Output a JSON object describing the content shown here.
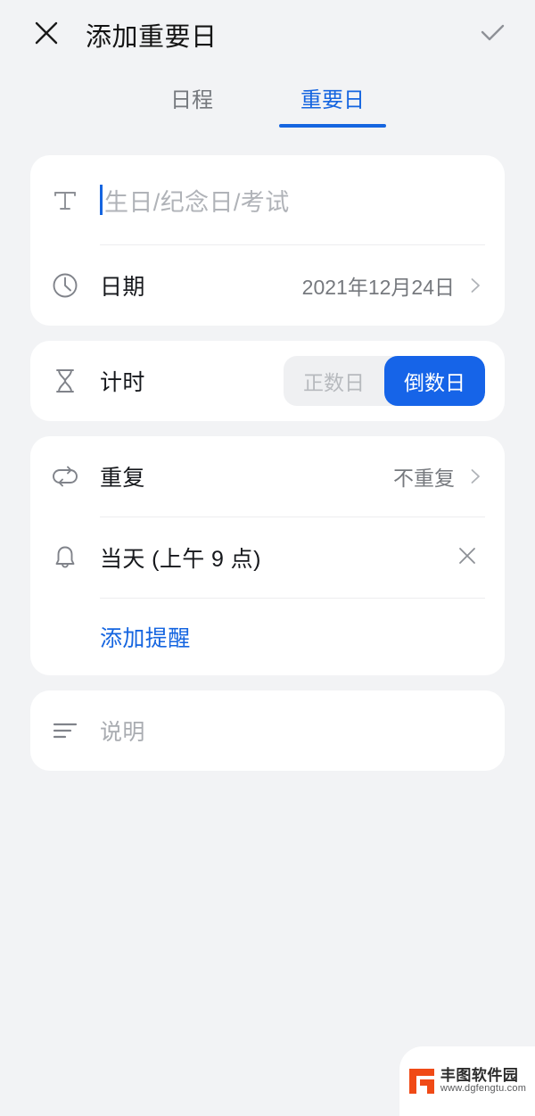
{
  "header": {
    "close_icon": "close-icon",
    "title": "添加重要日",
    "confirm_icon": "check-icon"
  },
  "tabs": [
    {
      "label": "日程",
      "active": false
    },
    {
      "label": "重要日",
      "active": true
    }
  ],
  "form": {
    "title_field": {
      "icon": "text-format-icon",
      "placeholder": "生日/纪念日/考试",
      "value": ""
    },
    "date_row": {
      "icon": "clock-icon",
      "label": "日期",
      "value": "2021年12月24日",
      "chevron": "chevron-right-icon"
    },
    "timing_row": {
      "icon": "hourglass-icon",
      "label": "计时",
      "options": [
        {
          "label": "正数日",
          "active": false
        },
        {
          "label": "倒数日",
          "active": true
        }
      ]
    },
    "repeat_row": {
      "icon": "repeat-icon",
      "label": "重复",
      "value": "不重复",
      "chevron": "chevron-right-icon"
    },
    "reminder_row": {
      "icon": "bell-icon",
      "label": "当天 (上午 9 点)",
      "clear_icon": "close-icon"
    },
    "add_reminder_link": "添加提醒",
    "description_row": {
      "icon": "description-lines-icon",
      "placeholder": "说明"
    }
  },
  "watermark": {
    "name": "丰图软件园",
    "url": "www.dgfengtu.com"
  },
  "colors": {
    "accent": "#1565e0",
    "accent_fill": "#1664e8",
    "page_bg": "#f2f3f5",
    "card_bg": "#ffffff",
    "text_primary": "#16181c",
    "text_secondary": "#76797e",
    "text_placeholder": "#b0b3b8",
    "watermark_logo": "#f04a16"
  }
}
